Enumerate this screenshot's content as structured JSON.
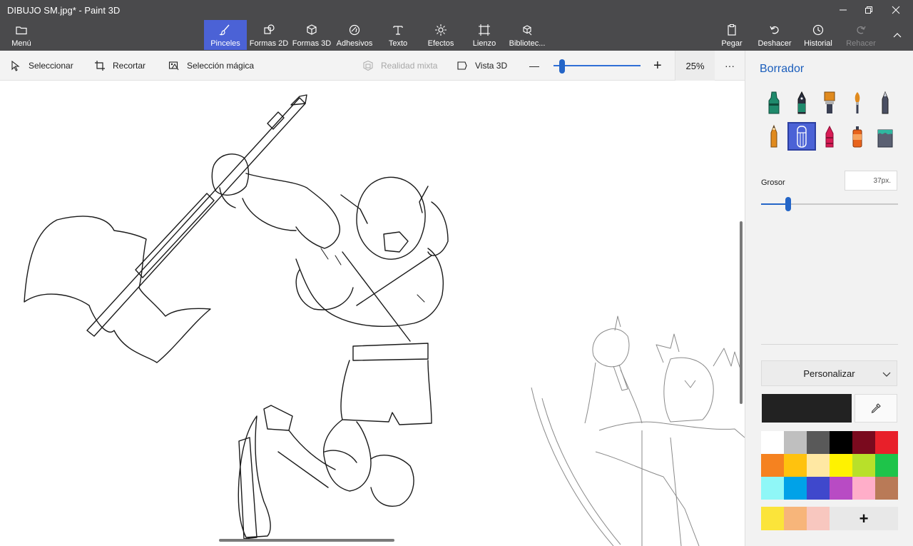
{
  "window": {
    "title": "DIBUJO SM.jpg* - Paint 3D"
  },
  "ribbon": {
    "menu_label": "Menú",
    "tabs": [
      {
        "label": "Pinceles",
        "icon": "brush-icon",
        "active": true
      },
      {
        "label": "Formas 2D",
        "icon": "shapes-2d-icon"
      },
      {
        "label": "Formas 3D",
        "icon": "cube-icon"
      },
      {
        "label": "Adhesivos",
        "icon": "sticker-icon"
      },
      {
        "label": "Texto",
        "icon": "text-icon"
      },
      {
        "label": "Efectos",
        "icon": "effects-icon"
      },
      {
        "label": "Lienzo",
        "icon": "canvas-icon"
      },
      {
        "label": "Bibliotec...",
        "icon": "library-icon"
      }
    ],
    "actions": [
      {
        "label": "Pegar",
        "icon": "paste-icon"
      },
      {
        "label": "Deshacer",
        "icon": "undo-icon"
      },
      {
        "label": "Historial",
        "icon": "history-icon"
      },
      {
        "label": "Rehacer",
        "icon": "redo-icon",
        "disabled": true
      }
    ]
  },
  "toolbar": {
    "select_label": "Seleccionar",
    "crop_label": "Recortar",
    "magic_select_label": "Selección mágica",
    "mixed_reality_label": "Realidad mixta",
    "view3d_label": "Vista 3D",
    "zoom_out": "—",
    "zoom_in": "+",
    "zoom_percent": 25,
    "zoom_label": "25%",
    "more": "···"
  },
  "panel": {
    "title": "Borrador",
    "brushes": [
      {
        "name": "marker-icon",
        "color": "#1f8a6c"
      },
      {
        "name": "calligraphy-pen-icon",
        "color": "#1f8a6c"
      },
      {
        "name": "oil-brush-icon",
        "color": "#e08a1e"
      },
      {
        "name": "watercolor-icon",
        "color": "#e08a1e"
      },
      {
        "name": "pixel-pen-icon",
        "color": "#4a4f63"
      },
      {
        "name": "pencil-icon",
        "color": "#e08a1e"
      },
      {
        "name": "eraser-icon",
        "color": "#ffffff",
        "selected": true
      },
      {
        "name": "crayon-icon",
        "color": "#d81b55"
      },
      {
        "name": "spray-can-icon",
        "color": "#e8631c"
      },
      {
        "name": "fill-bucket-icon",
        "color": "#2fb8a0"
      }
    ],
    "thickness_label": "Grosor",
    "thickness_value": "37px.",
    "thickness_fraction": 0.2,
    "custom_label": "Personalizar",
    "current_color": "#222222",
    "palette": [
      "#ffffff",
      "#bfbfbf",
      "#595959",
      "#000000",
      "#7a0a1e",
      "#e8202a",
      "#f58220",
      "#ffc20e",
      "#ffe8a3",
      "#fff200",
      "#b8e02a",
      "#1ec44a",
      "#8ff7f7",
      "#00a2e8",
      "#3f48cc",
      "#b84bc4",
      "#ffaec9",
      "#b97a57"
    ],
    "recent_colors": [
      "#fbe43a",
      "#f7b57a",
      "#f8c7bf"
    ],
    "add_color_label": "+"
  }
}
